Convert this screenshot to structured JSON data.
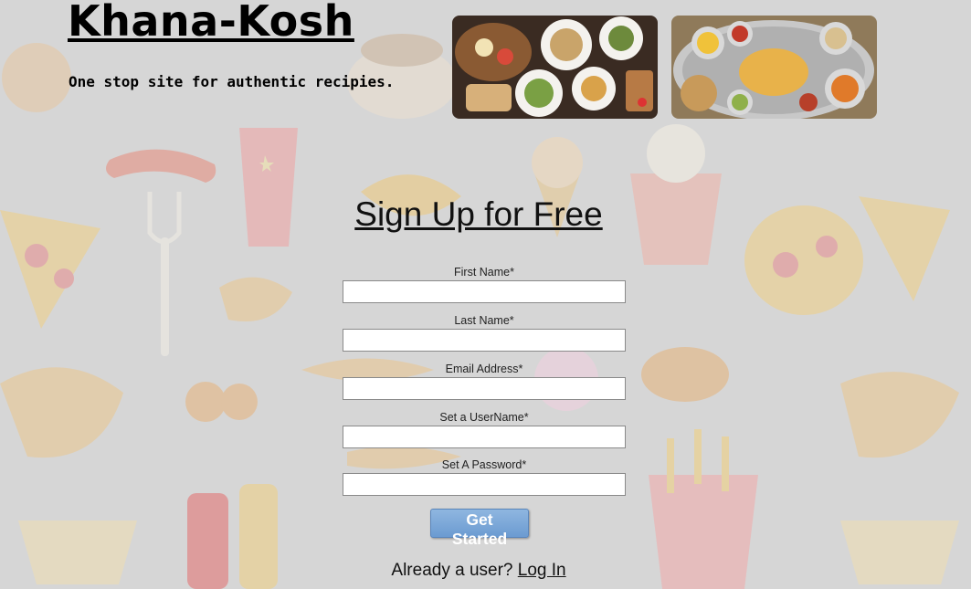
{
  "header": {
    "title": "Khana-Kosh",
    "tagline": "One stop site for authentic recipies."
  },
  "images": [
    {
      "name": "platter-image"
    },
    {
      "name": "thali-image"
    }
  ],
  "signup": {
    "heading": "Sign Up for Free",
    "fields": [
      {
        "label": "First Name*",
        "value": "",
        "placeholder": ""
      },
      {
        "label": "Last Name*",
        "value": "",
        "placeholder": ""
      },
      {
        "label": "Email Address*",
        "value": "",
        "placeholder": ""
      },
      {
        "label": "Set a UserName*",
        "value": "",
        "placeholder": ""
      },
      {
        "label": "Set A Password*",
        "value": "",
        "placeholder": ""
      }
    ],
    "submit_label": "Get Started"
  },
  "login": {
    "prompt": "Already a user?",
    "link_label": "Log In"
  },
  "colors": {
    "background": "#d6d6d6",
    "button": "#6b9bd1",
    "text": "#111111"
  }
}
